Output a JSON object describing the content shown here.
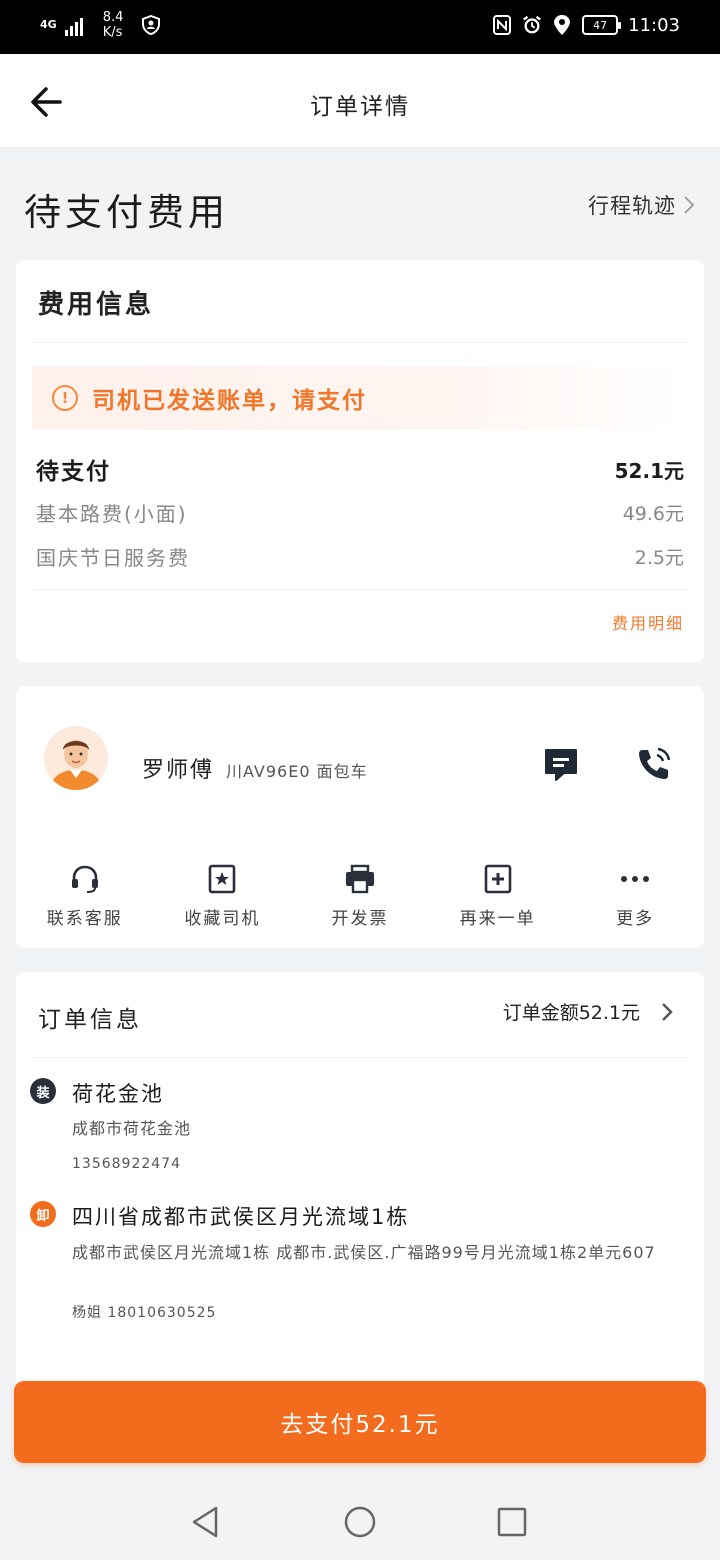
{
  "status_bar": {
    "network": "4G",
    "speed": "8.4",
    "speed_unit": "K/s",
    "battery": "47",
    "time": "11:03"
  },
  "header": {
    "title": "订单详情"
  },
  "page": {
    "heading": "待支付费用",
    "trip_link": "行程轨迹"
  },
  "fee_card": {
    "title": "费用信息",
    "alert": "司机已发送账单，请支付",
    "alert_icon": "!",
    "pending_label": "待支付",
    "pending_value": "52.1元",
    "items": [
      {
        "label": "基本路费(小面)",
        "value": "49.6元"
      },
      {
        "label": "国庆节日服务费",
        "value": "2.5元"
      }
    ],
    "detail_link": "费用明细"
  },
  "driver": {
    "name": "罗师傅",
    "plate": "川AV96E0 面包车",
    "actions": [
      {
        "label": "联系客服",
        "icon": "headset-icon"
      },
      {
        "label": "收藏司机",
        "icon": "star-box-icon"
      },
      {
        "label": "开发票",
        "icon": "printer-icon"
      },
      {
        "label": "再来一单",
        "icon": "plus-box-icon"
      },
      {
        "label": "更多",
        "icon": "more-icon"
      }
    ]
  },
  "order": {
    "title": "订单信息",
    "amount": "订单金额52.1元",
    "stops": [
      {
        "badge": "装",
        "name": "荷花金池",
        "address": "成都市荷花金池",
        "contact": "13568922474"
      },
      {
        "badge": "卸",
        "name": "四川省成都市武侯区月光流域1栋",
        "address": "成都市武侯区月光流域1栋 成都市.武侯区.广福路99号月光流域1栋2单元607",
        "contact": "杨姐 18010630525"
      }
    ]
  },
  "pay_button": {
    "label": "去支付52.1元"
  },
  "colors": {
    "accent": "#f36b1c",
    "alert_text": "#f0762a",
    "load_badge": "#2a2f3a",
    "unload_badge": "#f36b1c"
  }
}
